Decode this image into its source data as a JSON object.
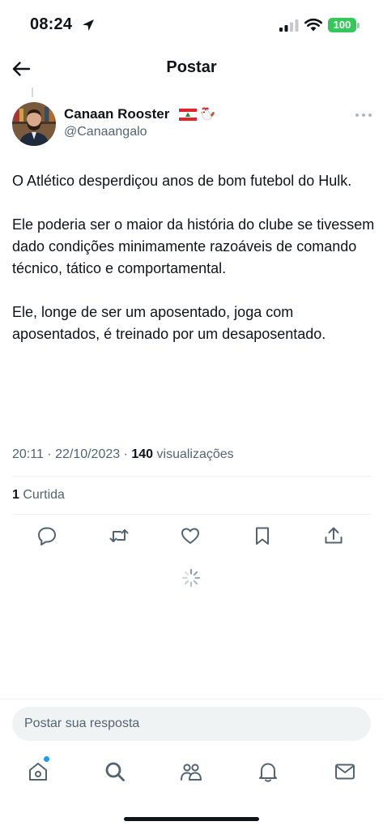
{
  "status_bar": {
    "time": "08:24",
    "battery": "100",
    "battery_color": "#34c759",
    "icons": [
      "location-arrow-icon",
      "cellular-signal-icon",
      "wifi-icon",
      "battery-icon"
    ]
  },
  "header": {
    "title": "Postar",
    "back_icon": "arrow-left-icon"
  },
  "tweet": {
    "author": {
      "name": "Canaan Rooster",
      "emoji": [
        "lebanon-flag-icon",
        "rooster-icon"
      ],
      "handle": "@Canaangalo"
    },
    "paragraphs": [
      "O Atlético desperdiçou anos de bom futebol do Hulk.",
      "Ele poderia ser o maior da história do clube se tivessem dado condições minimamente razoáveis de comando técnico, tático e comportamental.",
      "Ele, longe de ser um aposentado, joga com aposentados, é treinado por um desaposentado."
    ],
    "timestamp": "20:11 · 22/10/2023 · ",
    "views_count": "140",
    "views_label": " visualizações",
    "likes_count": "1",
    "likes_label": " Curtida"
  },
  "actions": [
    "reply-icon",
    "retweet-icon",
    "like-icon",
    "bookmark-icon",
    "share-icon"
  ],
  "reply": {
    "placeholder": "Postar sua resposta"
  },
  "tab_bar": {
    "items": [
      "home-icon",
      "search-icon",
      "communities-icon",
      "notifications-icon",
      "messages-icon"
    ],
    "accent": "#1d9bf0"
  }
}
